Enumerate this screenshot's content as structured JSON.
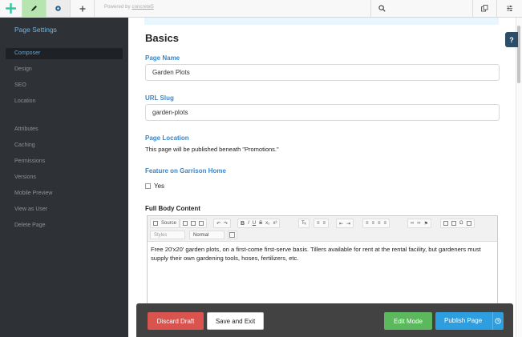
{
  "toolbar": {
    "powered_prefix": "Powered by",
    "powered_link": "concrete5"
  },
  "sidebar": {
    "title": "Page Settings",
    "items": [
      {
        "label": "Composer",
        "active": true
      },
      {
        "label": "Design"
      },
      {
        "label": "SEO"
      },
      {
        "label": "Location"
      },
      {
        "label": "Attributes"
      },
      {
        "label": "Caching"
      },
      {
        "label": "Permissions"
      },
      {
        "label": "Versions"
      },
      {
        "label": "Mobile Preview"
      },
      {
        "label": "View as User"
      },
      {
        "label": "Delete Page"
      }
    ]
  },
  "main": {
    "heading": "Basics",
    "page_name": {
      "label": "Page Name",
      "value": "Garden Plots"
    },
    "url_slug": {
      "label": "URL Slug",
      "value": "garden-plots"
    },
    "page_location": {
      "label": "Page Location",
      "text": "This page will be published beneath \"Promotions.\""
    },
    "feature": {
      "label": "Feature on Garrison Home",
      "option": "Yes"
    },
    "body": {
      "label": "Full Body Content",
      "source_label": "Source",
      "styles_label": "Styles",
      "format_label": "Normal",
      "content": "Free 20'x20' garden plots, on a first-come first-serve basis. Tillers available for rent at the rental facility, but gardeners must supply their own gardening tools, hoses, fertilizers, etc."
    }
  },
  "help": {
    "glyph": "?"
  },
  "footer": {
    "discard": "Discard Draft",
    "save": "Save and Exit",
    "edit_mode": "Edit Mode",
    "publish": "Publish Page"
  },
  "colors": {
    "accent": "#3a86c8",
    "sidebar_bg": "#2e3135",
    "discard": "#d9534f",
    "edit": "#5cb85c",
    "publish": "#2d9ee0"
  }
}
